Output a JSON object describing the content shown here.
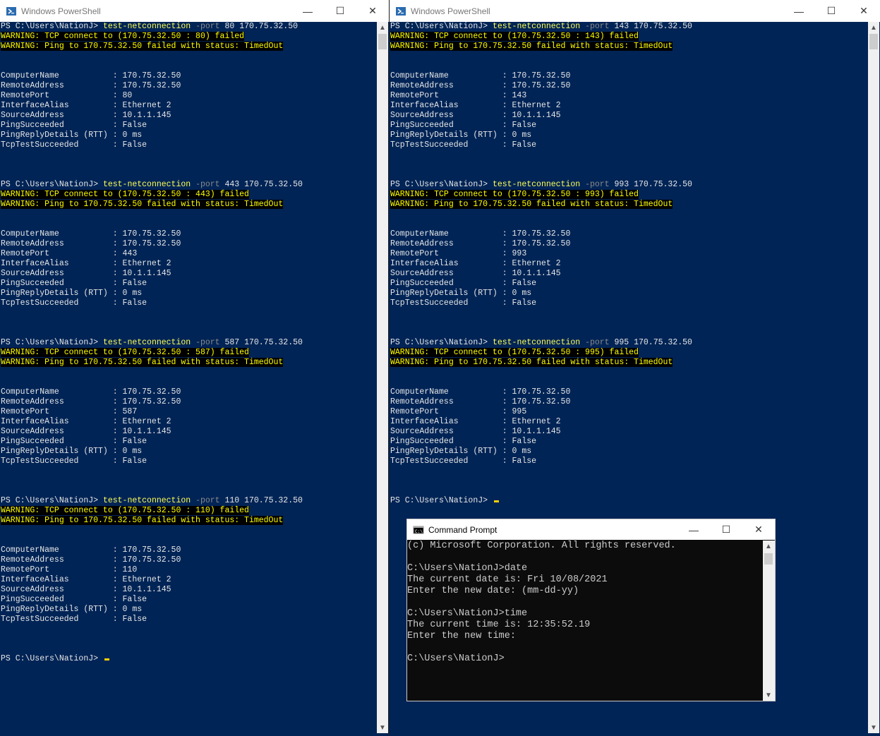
{
  "left_window": {
    "title": "Windows PowerShell",
    "lines": [
      {
        "t": "cmd",
        "prompt": "PS C:\\Users\\NationJ> ",
        "cmd": "test-netconnection",
        "param": "-port",
        "args": " 80 170.75.32.50"
      },
      {
        "t": "warn",
        "text": "WARNING: TCP connect to (170.75.32.50 : 80) failed"
      },
      {
        "t": "warn",
        "text": "WARNING: Ping to 170.75.32.50 failed with status: TimedOut"
      },
      {
        "t": "blank"
      },
      {
        "t": "blank"
      },
      {
        "t": "text",
        "text": "ComputerName           : 170.75.32.50"
      },
      {
        "t": "text",
        "text": "RemoteAddress          : 170.75.32.50"
      },
      {
        "t": "text",
        "text": "RemotePort             : 80"
      },
      {
        "t": "text",
        "text": "InterfaceAlias         : Ethernet 2"
      },
      {
        "t": "text",
        "text": "SourceAddress          : 10.1.1.145"
      },
      {
        "t": "text",
        "text": "PingSucceeded          : False"
      },
      {
        "t": "text",
        "text": "PingReplyDetails (RTT) : 0 ms"
      },
      {
        "t": "text",
        "text": "TcpTestSucceeded       : False"
      },
      {
        "t": "blank"
      },
      {
        "t": "blank"
      },
      {
        "t": "blank"
      },
      {
        "t": "cmd",
        "prompt": "PS C:\\Users\\NationJ> ",
        "cmd": "test-netconnection",
        "param": "-port",
        "args": " 443 170.75.32.50"
      },
      {
        "t": "warn",
        "text": "WARNING: TCP connect to (170.75.32.50 : 443) failed"
      },
      {
        "t": "warn",
        "text": "WARNING: Ping to 170.75.32.50 failed with status: TimedOut"
      },
      {
        "t": "blank"
      },
      {
        "t": "blank"
      },
      {
        "t": "text",
        "text": "ComputerName           : 170.75.32.50"
      },
      {
        "t": "text",
        "text": "RemoteAddress          : 170.75.32.50"
      },
      {
        "t": "text",
        "text": "RemotePort             : 443"
      },
      {
        "t": "text",
        "text": "InterfaceAlias         : Ethernet 2"
      },
      {
        "t": "text",
        "text": "SourceAddress          : 10.1.1.145"
      },
      {
        "t": "text",
        "text": "PingSucceeded          : False"
      },
      {
        "t": "text",
        "text": "PingReplyDetails (RTT) : 0 ms"
      },
      {
        "t": "text",
        "text": "TcpTestSucceeded       : False"
      },
      {
        "t": "blank"
      },
      {
        "t": "blank"
      },
      {
        "t": "blank"
      },
      {
        "t": "cmd",
        "prompt": "PS C:\\Users\\NationJ> ",
        "cmd": "test-netconnection",
        "param": "-port",
        "args": " 587 170.75.32.50"
      },
      {
        "t": "warn",
        "text": "WARNING: TCP connect to (170.75.32.50 : 587) failed"
      },
      {
        "t": "warn",
        "text": "WARNING: Ping to 170.75.32.50 failed with status: TimedOut"
      },
      {
        "t": "blank"
      },
      {
        "t": "blank"
      },
      {
        "t": "text",
        "text": "ComputerName           : 170.75.32.50"
      },
      {
        "t": "text",
        "text": "RemoteAddress          : 170.75.32.50"
      },
      {
        "t": "text",
        "text": "RemotePort             : 587"
      },
      {
        "t": "text",
        "text": "InterfaceAlias         : Ethernet 2"
      },
      {
        "t": "text",
        "text": "SourceAddress          : 10.1.1.145"
      },
      {
        "t": "text",
        "text": "PingSucceeded          : False"
      },
      {
        "t": "text",
        "text": "PingReplyDetails (RTT) : 0 ms"
      },
      {
        "t": "text",
        "text": "TcpTestSucceeded       : False"
      },
      {
        "t": "blank"
      },
      {
        "t": "blank"
      },
      {
        "t": "blank"
      },
      {
        "t": "cmd",
        "prompt": "PS C:\\Users\\NationJ> ",
        "cmd": "test-netconnection",
        "param": "-port",
        "args": " 110 170.75.32.50"
      },
      {
        "t": "warn",
        "text": "WARNING: TCP connect to (170.75.32.50 : 110) failed"
      },
      {
        "t": "warn",
        "text": "WARNING: Ping to 170.75.32.50 failed with status: TimedOut"
      },
      {
        "t": "blank"
      },
      {
        "t": "blank"
      },
      {
        "t": "text",
        "text": "ComputerName           : 170.75.32.50"
      },
      {
        "t": "text",
        "text": "RemoteAddress          : 170.75.32.50"
      },
      {
        "t": "text",
        "text": "RemotePort             : 110"
      },
      {
        "t": "text",
        "text": "InterfaceAlias         : Ethernet 2"
      },
      {
        "t": "text",
        "text": "SourceAddress          : 10.1.1.145"
      },
      {
        "t": "text",
        "text": "PingSucceeded          : False"
      },
      {
        "t": "text",
        "text": "PingReplyDetails (RTT) : 0 ms"
      },
      {
        "t": "text",
        "text": "TcpTestSucceeded       : False"
      },
      {
        "t": "blank"
      },
      {
        "t": "blank"
      },
      {
        "t": "blank"
      },
      {
        "t": "prompt",
        "prompt": "PS C:\\Users\\NationJ> "
      }
    ]
  },
  "right_window": {
    "title": "Windows PowerShell",
    "lines": [
      {
        "t": "cmd",
        "prompt": "PS C:\\Users\\NationJ> ",
        "cmd": "test-netconnection",
        "param": "-port",
        "args": " 143 170.75.32.50"
      },
      {
        "t": "warn",
        "text": "WARNING: TCP connect to (170.75.32.50 : 143) failed"
      },
      {
        "t": "warn",
        "text": "WARNING: Ping to 170.75.32.50 failed with status: TimedOut"
      },
      {
        "t": "blank"
      },
      {
        "t": "blank"
      },
      {
        "t": "text",
        "text": "ComputerName           : 170.75.32.50"
      },
      {
        "t": "text",
        "text": "RemoteAddress          : 170.75.32.50"
      },
      {
        "t": "text",
        "text": "RemotePort             : 143"
      },
      {
        "t": "text",
        "text": "InterfaceAlias         : Ethernet 2"
      },
      {
        "t": "text",
        "text": "SourceAddress          : 10.1.1.145"
      },
      {
        "t": "text",
        "text": "PingSucceeded          : False"
      },
      {
        "t": "text",
        "text": "PingReplyDetails (RTT) : 0 ms"
      },
      {
        "t": "text",
        "text": "TcpTestSucceeded       : False"
      },
      {
        "t": "blank"
      },
      {
        "t": "blank"
      },
      {
        "t": "blank"
      },
      {
        "t": "cmd",
        "prompt": "PS C:\\Users\\NationJ> ",
        "cmd": "test-netconnection",
        "param": "-port",
        "args": " 993 170.75.32.50"
      },
      {
        "t": "warn",
        "text": "WARNING: TCP connect to (170.75.32.50 : 993) failed"
      },
      {
        "t": "warn",
        "text": "WARNING: Ping to 170.75.32.50 failed with status: TimedOut"
      },
      {
        "t": "blank"
      },
      {
        "t": "blank"
      },
      {
        "t": "text",
        "text": "ComputerName           : 170.75.32.50"
      },
      {
        "t": "text",
        "text": "RemoteAddress          : 170.75.32.50"
      },
      {
        "t": "text",
        "text": "RemotePort             : 993"
      },
      {
        "t": "text",
        "text": "InterfaceAlias         : Ethernet 2"
      },
      {
        "t": "text",
        "text": "SourceAddress          : 10.1.1.145"
      },
      {
        "t": "text",
        "text": "PingSucceeded          : False"
      },
      {
        "t": "text",
        "text": "PingReplyDetails (RTT) : 0 ms"
      },
      {
        "t": "text",
        "text": "TcpTestSucceeded       : False"
      },
      {
        "t": "blank"
      },
      {
        "t": "blank"
      },
      {
        "t": "blank"
      },
      {
        "t": "cmd",
        "prompt": "PS C:\\Users\\NationJ> ",
        "cmd": "test-netconnection",
        "param": "-port",
        "args": " 995 170.75.32.50"
      },
      {
        "t": "warn",
        "text": "WARNING: TCP connect to (170.75.32.50 : 995) failed"
      },
      {
        "t": "warn",
        "text": "WARNING: Ping to 170.75.32.50 failed with status: TimedOut"
      },
      {
        "t": "blank"
      },
      {
        "t": "blank"
      },
      {
        "t": "text",
        "text": "ComputerName           : 170.75.32.50"
      },
      {
        "t": "text",
        "text": "RemoteAddress          : 170.75.32.50"
      },
      {
        "t": "text",
        "text": "RemotePort             : 995"
      },
      {
        "t": "text",
        "text": "InterfaceAlias         : Ethernet 2"
      },
      {
        "t": "text",
        "text": "SourceAddress          : 10.1.1.145"
      },
      {
        "t": "text",
        "text": "PingSucceeded          : False"
      },
      {
        "t": "text",
        "text": "PingReplyDetails (RTT) : 0 ms"
      },
      {
        "t": "text",
        "text": "TcpTestSucceeded       : False"
      },
      {
        "t": "blank"
      },
      {
        "t": "blank"
      },
      {
        "t": "blank"
      },
      {
        "t": "prompt",
        "prompt": "PS C:\\Users\\NationJ> "
      }
    ]
  },
  "cmd_window": {
    "title": "Command Prompt",
    "lines": [
      "(c) Microsoft Corporation. All rights reserved.",
      "",
      "C:\\Users\\NationJ>date",
      "The current date is: Fri 10/08/2021",
      "Enter the new date: (mm-dd-yy)",
      "",
      "C:\\Users\\NationJ>time",
      "The current time is: 12:35:52.19",
      "Enter the new time:",
      "",
      "C:\\Users\\NationJ>"
    ]
  },
  "controls": {
    "minimize": "—",
    "maximize": "☐",
    "close": "✕"
  },
  "colors": {
    "powershell_bg": "#012456",
    "warning_fg": "#ffff00",
    "command_fg": "#ffff55",
    "param_fg": "#8a8a8a",
    "cmd_bg": "#0c0c0c"
  }
}
